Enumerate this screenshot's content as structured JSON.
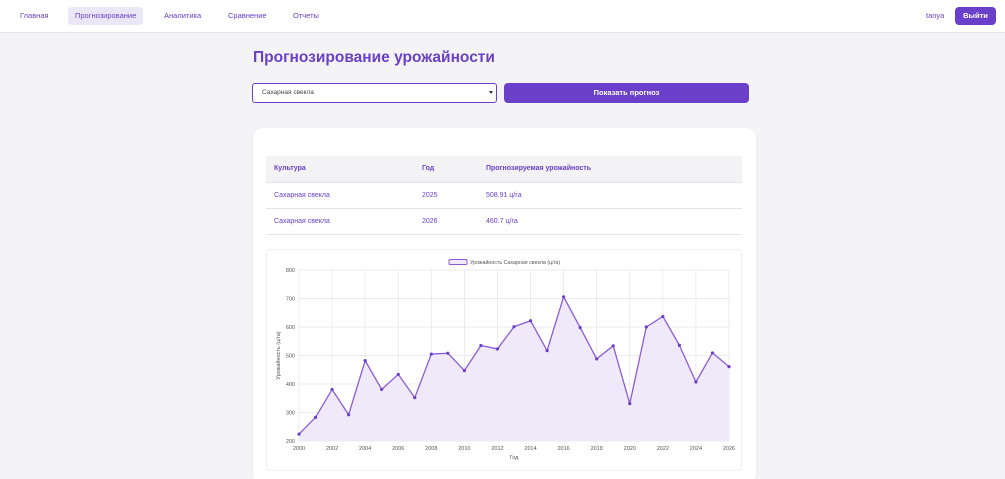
{
  "nav": {
    "items": [
      "Главная",
      "Прогнозирование",
      "Аналитика",
      "Сравнение",
      "Отчеты"
    ],
    "active_index": 1,
    "user": "tanya",
    "logout_label": "Выйти"
  },
  "page": {
    "title": "Прогнозирование урожайности"
  },
  "controls": {
    "selected_crop": "Сахарная свекла",
    "forecast_button": "Показать прогноз"
  },
  "table": {
    "headers": [
      "Культура",
      "Год",
      "Прогнозируемая урожайность"
    ],
    "rows": [
      [
        "Сахарная свекла",
        "2025",
        "508.91 ц/га"
      ],
      [
        "Сахарная свекла",
        "2026",
        "460.7 ц/га"
      ]
    ]
  },
  "colors": {
    "accent": "#6a3fc9",
    "line": "#8a5cd6",
    "fill": "#efe9f9"
  },
  "chart_data": {
    "type": "area",
    "legend": "Урожайность Сахарная свекла (ц/га)",
    "legend_position": "top",
    "xlabel": "Год",
    "ylabel": "Урожайность (ц/га)",
    "ylim": [
      200,
      800
    ],
    "yticks": [
      200,
      300,
      400,
      500,
      600,
      700,
      800
    ],
    "xlim": [
      2000,
      2026
    ],
    "xticks": [
      2000,
      2002,
      2004,
      2006,
      2008,
      2010,
      2012,
      2014,
      2016,
      2018,
      2020,
      2022,
      2024,
      2026
    ],
    "grid": true,
    "x": [
      2000,
      2001,
      2002,
      2003,
      2004,
      2005,
      2006,
      2007,
      2008,
      2009,
      2010,
      2011,
      2012,
      2013,
      2014,
      2015,
      2016,
      2017,
      2018,
      2019,
      2020,
      2021,
      2022,
      2023,
      2024,
      2025,
      2026
    ],
    "values": [
      224,
      283,
      381,
      292,
      482,
      381,
      434,
      352,
      505,
      508,
      447,
      535,
      523,
      601,
      622,
      517,
      706,
      598,
      488,
      534,
      331,
      600,
      637,
      536,
      407,
      509,
      461
    ]
  }
}
